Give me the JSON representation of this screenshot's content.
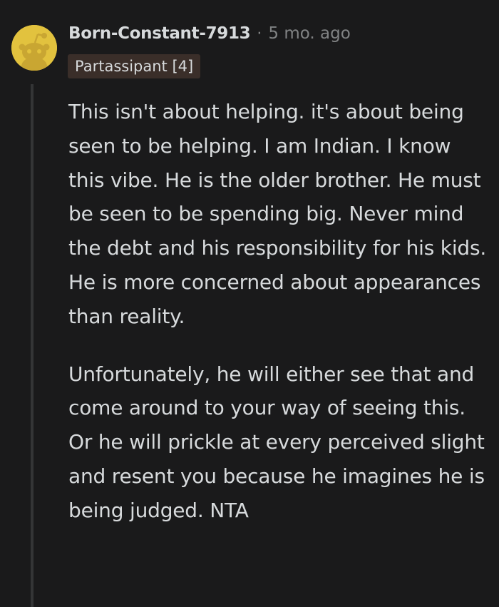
{
  "comment": {
    "author": "Born-Constant-7913",
    "separator": "·",
    "timestamp": "5 mo. ago",
    "flair": "Partassipant [4]",
    "avatar_icon": "snoo-avatar-icon",
    "colors": {
      "background": "#1a1a1b",
      "text": "#d7dadc",
      "meta": "#818384",
      "flair_bg": "#3a2e29",
      "avatar_bg": "#e2c23e",
      "thread_line": "#343536"
    },
    "paragraphs": [
      "This isn't about helping. it's about being seen to be helping. I am Indian. I know this vibe. He is the older brother. He must be seen to be spending big. Never mind the debt and his responsibility for his kids. He is more concerned about appearances than reality.",
      "Unfortunately, he will either see that and come around to your way of seeing this. Or he will prickle at every perceived slight and resent you because he imagines he is being judged. NTA"
    ]
  }
}
